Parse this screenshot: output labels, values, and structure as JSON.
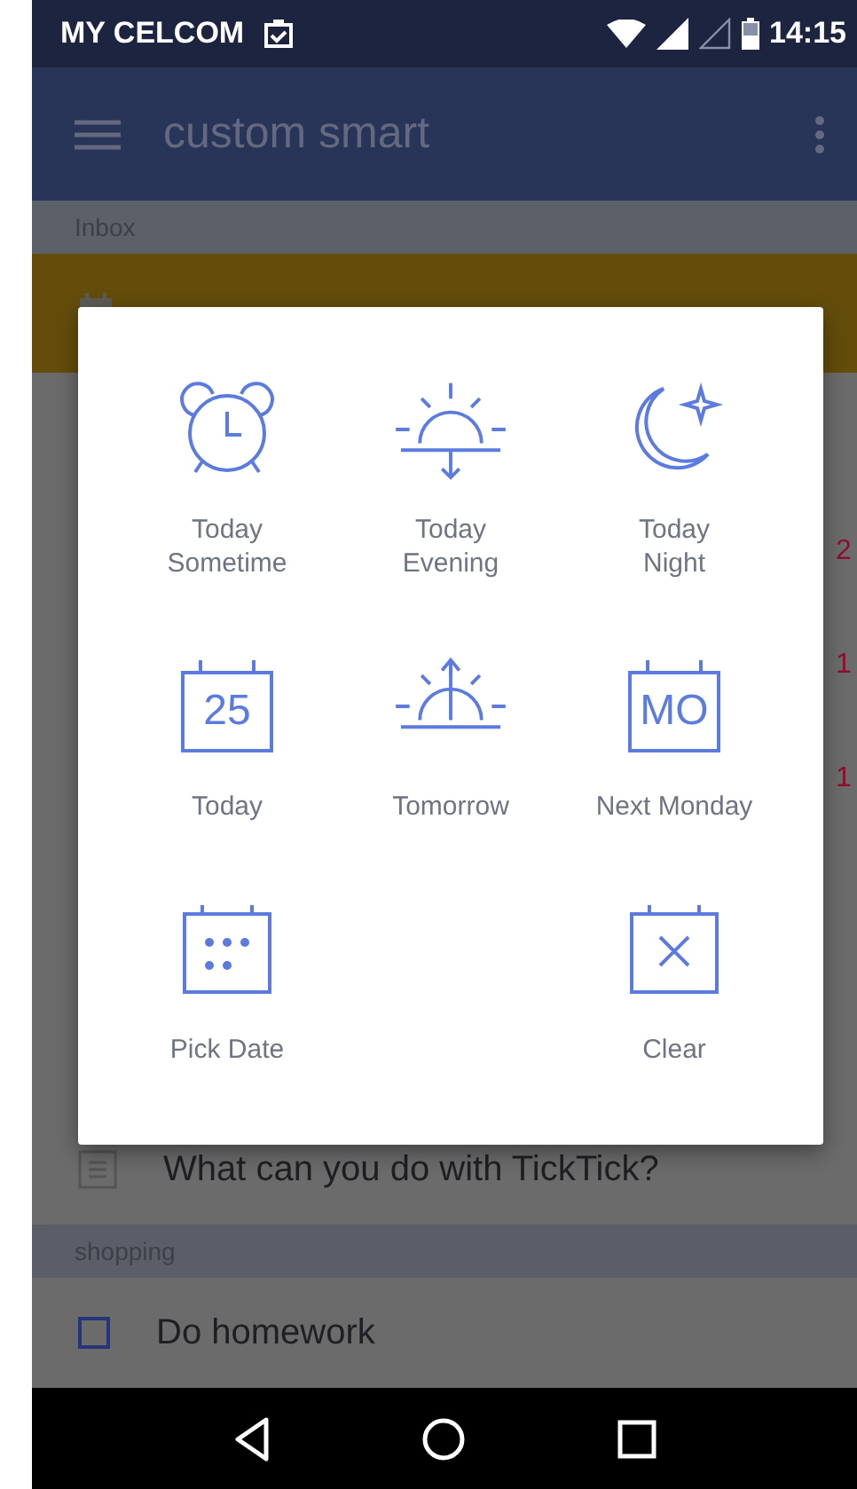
{
  "status_bar": {
    "carrier": "MY CELCOM",
    "time": "14:15"
  },
  "app_bar": {
    "title": "custom smart"
  },
  "list": {
    "section": "Inbox",
    "hidden_rows": [
      {
        "count": "2"
      },
      {
        "count": "1"
      },
      {
        "count": "1"
      }
    ],
    "note_row": {
      "title": "What can you do with TickTick?"
    },
    "section_2": "shopping",
    "task": {
      "title": "Do homework",
      "checked": false
    }
  },
  "dialog": {
    "rows": [
      [
        {
          "kind": "alarm",
          "label": "Today\nSometime"
        },
        {
          "kind": "evening",
          "label": "Today\nEvening"
        },
        {
          "kind": "night",
          "label": "Today\nNight"
        }
      ],
      [
        {
          "kind": "date",
          "icon_text": "25",
          "label": "Today"
        },
        {
          "kind": "tomorrow",
          "label": "Tomorrow"
        },
        {
          "kind": "date",
          "icon_text": "MO",
          "label": "Next Monday"
        }
      ],
      [
        {
          "kind": "pick",
          "label": "Pick Date"
        },
        null,
        {
          "kind": "clear",
          "label": "Clear"
        }
      ]
    ]
  }
}
